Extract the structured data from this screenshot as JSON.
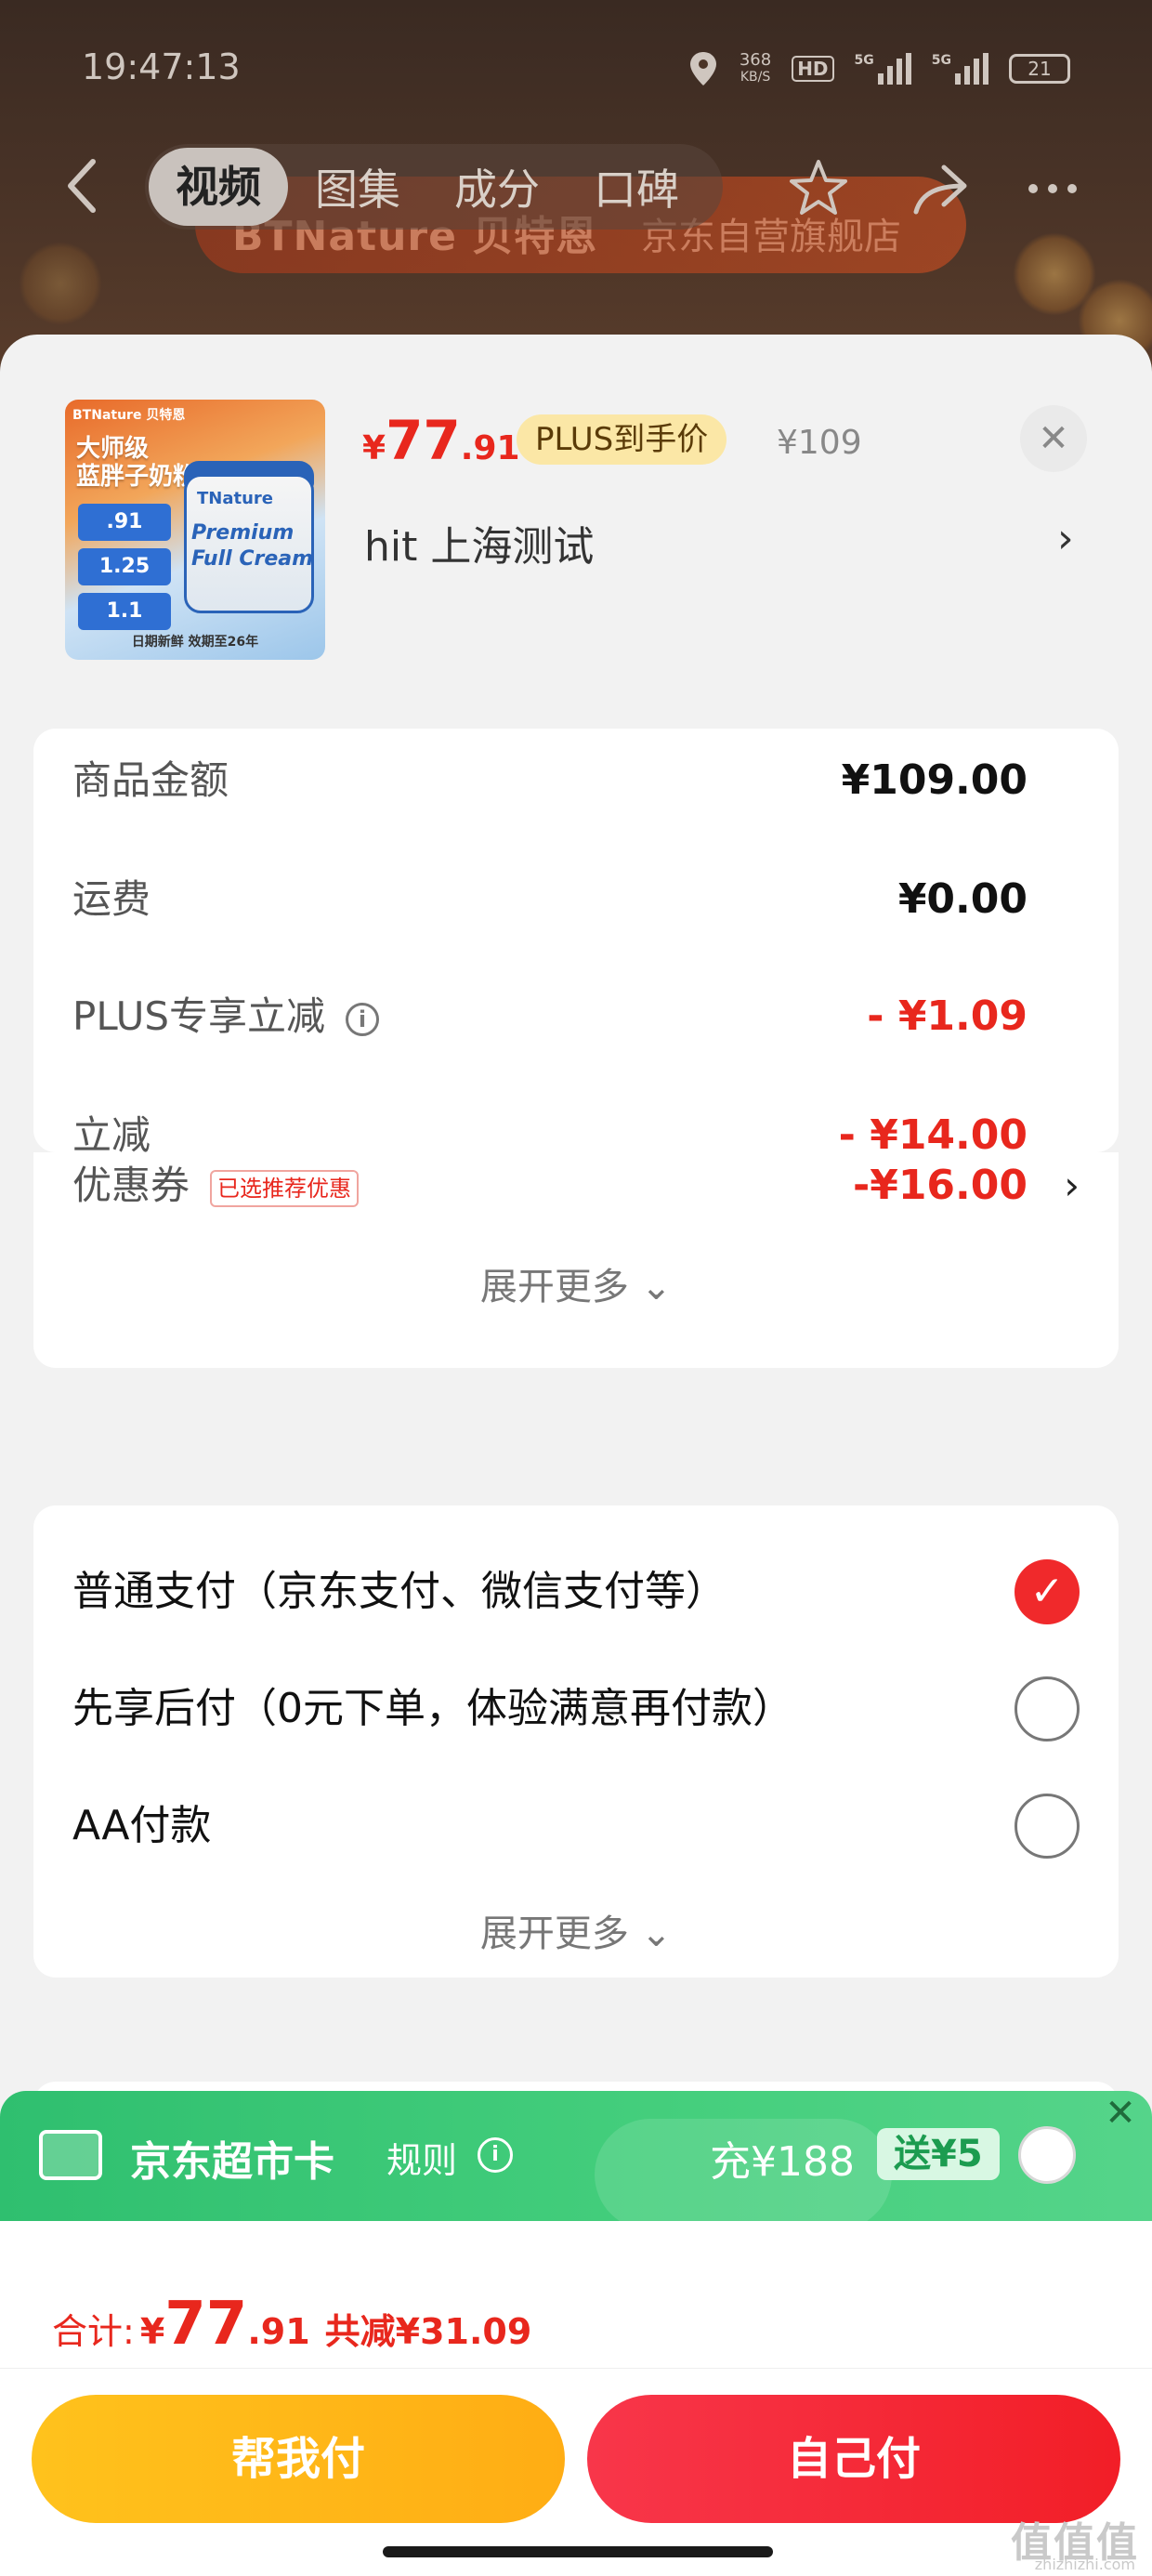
{
  "status_bar": {
    "time": "19:47:13",
    "net_speed": "368",
    "net_unit": "KB/S",
    "hd": "HD",
    "sig1": "5G",
    "sig2": "5G",
    "battery": "21"
  },
  "nav": {
    "tabs": [
      {
        "label": "视频",
        "active": true
      },
      {
        "label": "图集",
        "active": false
      },
      {
        "label": "成分",
        "active": false
      },
      {
        "label": "口碑",
        "active": false
      }
    ]
  },
  "banner": {
    "brand": "BTNature 贝特恩",
    "store": "京东自营旗舰店"
  },
  "product": {
    "price_symbol": "¥",
    "price_int": "77",
    "price_dec": ".91",
    "plus_label": "PLUS到手价",
    "original_price": "¥109",
    "spec": "hit  上海测试",
    "thumb": {
      "tag": "BTNature 贝特恩",
      "title_1": "大师级",
      "title_2": "蓝胖子奶粉",
      "box_1": ".91",
      "box_2": "1.25",
      "box_3": "1.1",
      "can_brand": "TNature",
      "can_text_1": "Premium",
      "can_text_2": "Full Cream",
      "footer": "日期新鲜 效期至26年"
    }
  },
  "fees": {
    "items": [
      {
        "label": "商品金额",
        "value": "¥109.00",
        "red": false
      },
      {
        "label": "运费",
        "value": "¥0.00",
        "red": false
      },
      {
        "label": "PLUS专享立减",
        "value": "- ¥1.09",
        "red": true,
        "info": true
      },
      {
        "label": "立减",
        "value": "- ¥14.00",
        "red": true
      },
      {
        "label": "优惠券",
        "value": "-¥16.00",
        "red": true,
        "tag": "已选推荐优惠",
        "arrow": true
      }
    ],
    "expand_label": "展开更多"
  },
  "payment": {
    "options": [
      {
        "label": "普通支付（京东支付、微信支付等）",
        "checked": true
      },
      {
        "label": "先享后付（0元下单，体验满意再付款）",
        "checked": false
      },
      {
        "label": "AA付款",
        "checked": false
      }
    ],
    "expand_label": "展开更多"
  },
  "market_card": {
    "title": "京东超市卡",
    "rule": "规则",
    "charge": "充¥188",
    "gift": "送¥5"
  },
  "total": {
    "label": "合计:",
    "symbol": "¥",
    "int": "77",
    "dec": ".91",
    "saving": "共减¥31.09"
  },
  "actions": {
    "help_pay": "帮我付",
    "self_pay": "自己付"
  },
  "watermark": {
    "main": "值值值",
    "sub": "zhizhizhi.com"
  },
  "colors": {
    "accent_red": "#e8271d",
    "market_green": "#2fbf6f",
    "help_yellow": "#ffb414"
  }
}
